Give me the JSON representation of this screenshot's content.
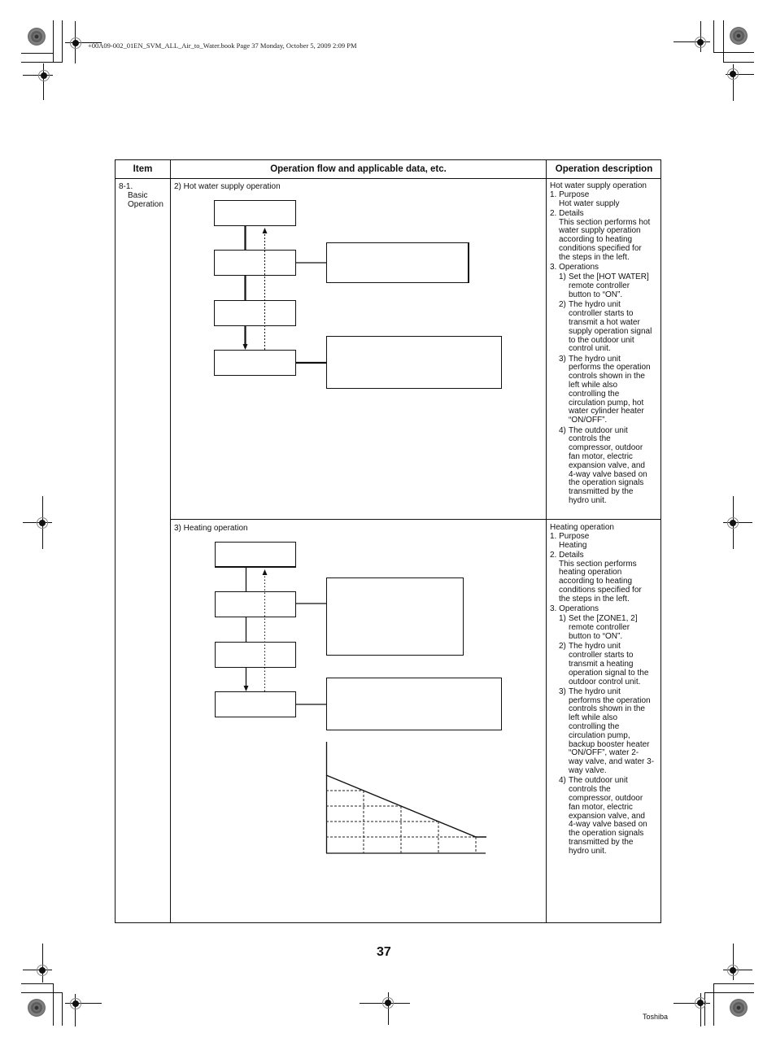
{
  "print_header": "+00A09-002_01EN_SVM_ALL_Air_to_Water.book  Page 37  Monday, October 5, 2009  2:09 PM",
  "table": {
    "headers": {
      "item": "Item",
      "flow": "Operation flow and applicable data, etc.",
      "description": "Operation description"
    },
    "item": {
      "number": "8-1.",
      "line1": "Basic",
      "line2": "Operation"
    },
    "sections": [
      {
        "flow_title": "2) Hot water supply operation",
        "description": {
          "title": "Hot water supply operation",
          "purpose_label": "1. Purpose",
          "purpose": "Hot water supply",
          "details_label": "2. Details",
          "details": [
            "This section performs hot",
            "water supply operation",
            "according to heating",
            "conditions specified for",
            "the steps in the left."
          ],
          "operations_label": "3. Operations",
          "operations": [
            {
              "n": "1)",
              "lines": [
                "Set the [HOT WATER]",
                "remote controller",
                "button to “ON”."
              ]
            },
            {
              "n": "2)",
              "lines": [
                "The hydro unit",
                "controller starts to",
                "transmit a hot water",
                "supply operation signal",
                "to the outdoor unit",
                "control unit."
              ]
            },
            {
              "n": "3)",
              "lines": [
                "The hydro unit",
                "performs the operation",
                "controls shown in the",
                "left while also",
                "controlling the",
                "circulation pump, hot",
                "water cylinder heater",
                "“ON/OFF”."
              ]
            },
            {
              "n": "4)",
              "lines": [
                "The outdoor unit",
                "controls the",
                "compressor, outdoor",
                "fan motor, electric",
                "expansion valve, and",
                "4-way valve based on",
                "the operation signals",
                "transmitted by the",
                "hydro unit."
              ]
            }
          ]
        }
      },
      {
        "flow_title": "3) Heating operation",
        "description": {
          "title": "Heating operation",
          "purpose_label": "1. Purpose",
          "purpose": "Heating",
          "details_label": "2. Details",
          "details": [
            "This section performs",
            "heating operation",
            "according to heating",
            "conditions specified for",
            "the steps in the left."
          ],
          "operations_label": "3. Operations",
          "operations": [
            {
              "n": "1)",
              "lines": [
                "Set the [ZONE1, 2]",
                "remote controller",
                "button to “ON”."
              ]
            },
            {
              "n": "2)",
              "lines": [
                "The hydro unit",
                "controller starts to",
                "transmit a heating",
                "operation signal to the",
                "outdoor control unit."
              ]
            },
            {
              "n": "3)",
              "lines": [
                "The hydro unit",
                "performs the operation",
                "controls shown in the",
                "left while also",
                "controlling the",
                "circulation pump,",
                "backup booster heater",
                "“ON/OFF”, water 2-",
                "way valve, and water 3-",
                "way valve."
              ]
            },
            {
              "n": "4)",
              "lines": [
                "The outdoor unit",
                "controls the",
                "compressor, outdoor",
                "fan motor, electric",
                "expansion valve, and",
                "4-way valve based on",
                "the operation signals",
                "transmitted by the",
                "hydro unit."
              ]
            }
          ]
        }
      }
    ]
  },
  "page_number": "37",
  "brand": "Toshiba"
}
